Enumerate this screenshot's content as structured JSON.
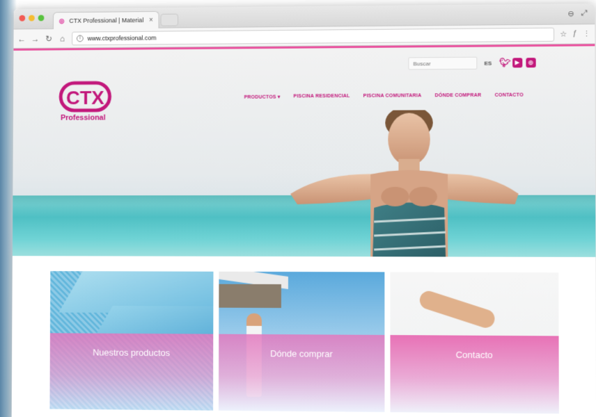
{
  "browser": {
    "tab_title": "CTX Professional | Material ...",
    "tab_favicon": "CTX",
    "url": "www.ctxprofessional.com"
  },
  "header": {
    "search_placeholder": "Buscar",
    "language": "ES",
    "logo_brand": "CTX",
    "logo_subtitle": "Professional",
    "social": [
      "twitter-icon",
      "youtube-icon",
      "instagram-icon"
    ]
  },
  "nav": {
    "items": [
      {
        "label": "PRODUCTOS ▾"
      },
      {
        "label": "PISCINA RESIDENCIAL"
      },
      {
        "label": "PISCINA COMUNITARIA"
      },
      {
        "label": "DÓNDE COMPRAR"
      },
      {
        "label": "CONTACTO"
      }
    ]
  },
  "tiles": [
    {
      "label": "Nuestros productos"
    },
    {
      "label": "Dónde comprar"
    },
    {
      "label": "Contacto"
    }
  ],
  "colors": {
    "brand": "#c2187b",
    "accent_line": "#e2197f"
  }
}
